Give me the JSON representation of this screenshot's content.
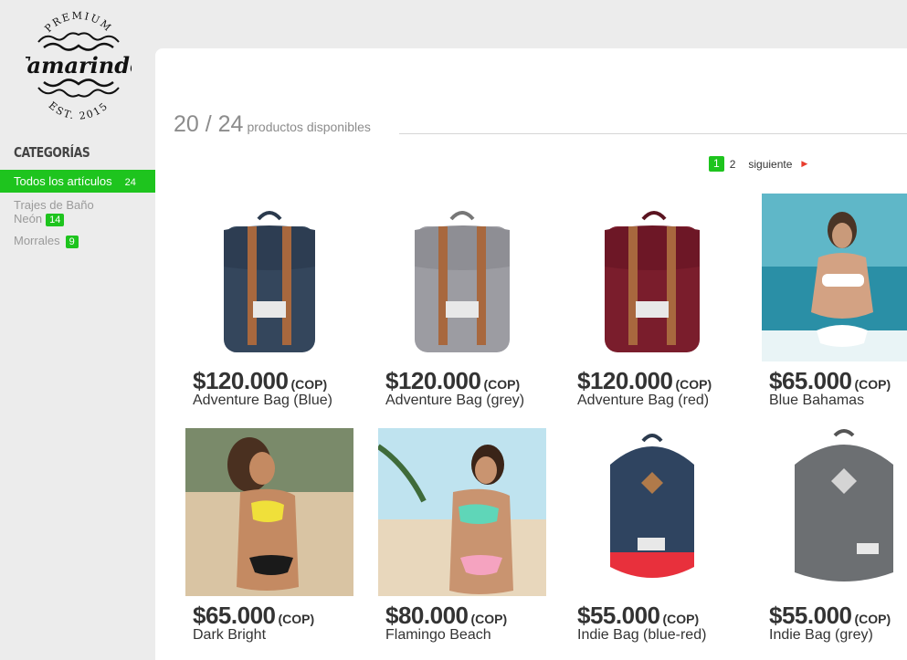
{
  "brand": {
    "top_text": "PREMIUM",
    "name": "Tamarindo",
    "bottom_text": "EST. 2015"
  },
  "sidebar": {
    "title": "CATEGORÍAS",
    "items": [
      {
        "label": "Todos los artículos",
        "count": "24",
        "active": true
      },
      {
        "label_line1": "Trajes de Baño",
        "label_line2": "Neón",
        "count": "14"
      },
      {
        "label": "Morrales",
        "count": "9"
      }
    ]
  },
  "listing": {
    "shown": "20 / 24",
    "label": "productos disponibles"
  },
  "pagination": {
    "current": "1",
    "next_page": "2",
    "next_label": "siguiente",
    "arrow": "▶"
  },
  "colors": {
    "accent_green": "#1ec41e",
    "arrow_red": "#e83c2d"
  },
  "products": [
    {
      "price": "$120.000",
      "currency": "(COP)",
      "name": "Adventure Bag (Blue)",
      "image": "backpack-navy"
    },
    {
      "price": "$120.000",
      "currency": "(COP)",
      "name": "Adventure Bag (grey)",
      "image": "backpack-grey"
    },
    {
      "price": "$120.000",
      "currency": "(COP)",
      "name": "Adventure Bag (red)",
      "image": "backpack-burgundy"
    },
    {
      "price": "$65.000",
      "currency": "(COP)",
      "name": "Blue Bahamas",
      "image": "swimsuit-photo-white"
    },
    {
      "price": "$65.000",
      "currency": "(COP)",
      "name": "Dark Bright",
      "image": "swimsuit-photo-yellow"
    },
    {
      "price": "$80.000",
      "currency": "(COP)",
      "name": "Flamingo Beach",
      "image": "swimsuit-photo-mint"
    },
    {
      "price": "$55.000",
      "currency": "(COP)",
      "name": "Indie Bag (blue-red)",
      "image": "backpack-blue-red"
    },
    {
      "price": "$55.000",
      "currency": "(COP)",
      "name": "Indie Bag (grey)",
      "image": "backpack-heather-grey"
    }
  ]
}
